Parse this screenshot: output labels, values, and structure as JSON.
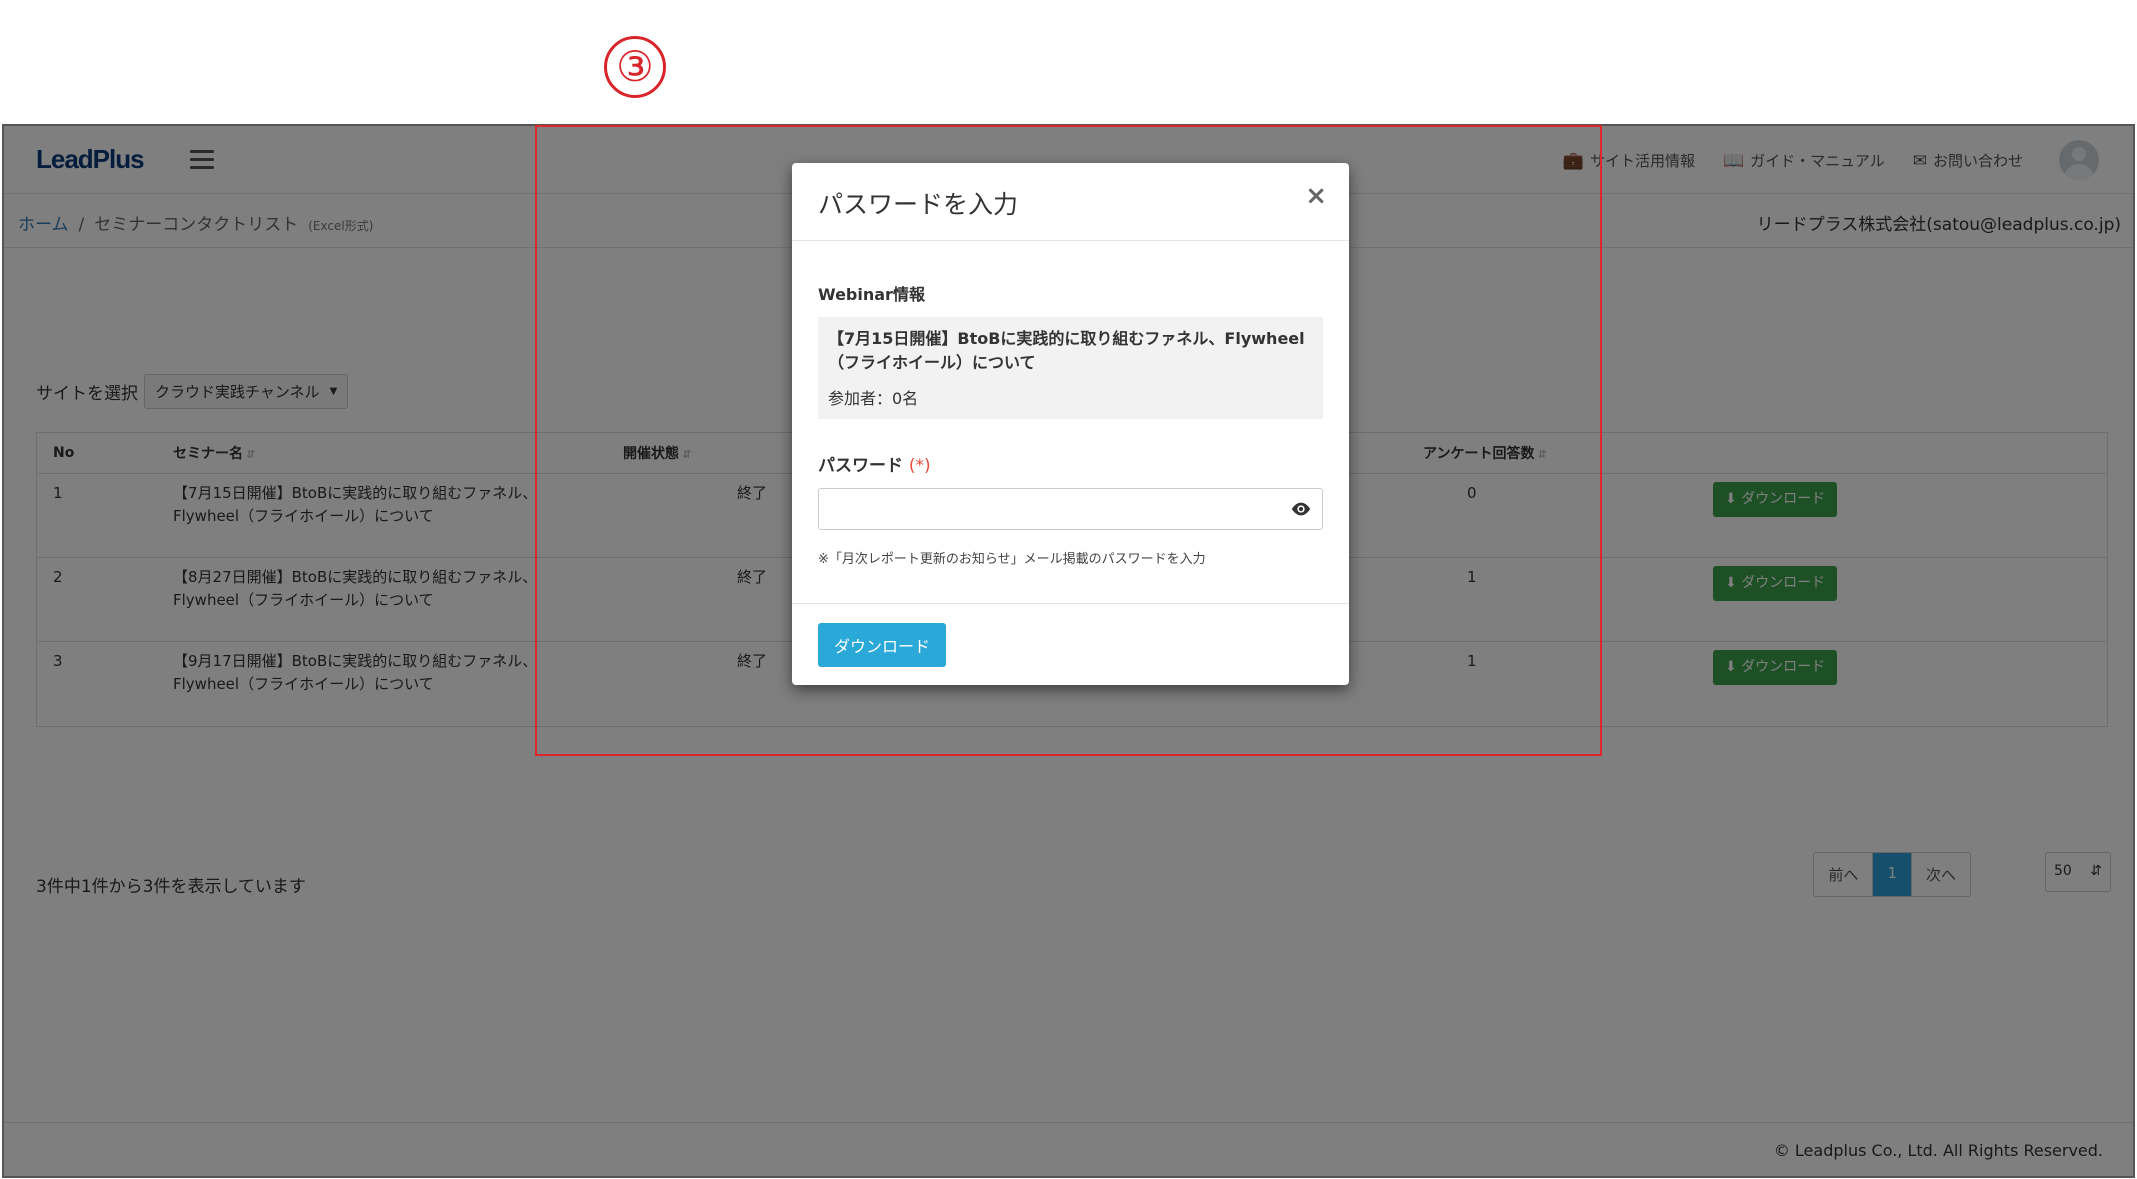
{
  "marker": "③",
  "navbar": {
    "logo": "LeadPlus",
    "links": [
      {
        "icon": "briefcase-icon",
        "label": "サイト活用情報"
      },
      {
        "icon": "book-icon",
        "label": "ガイド・マニュアル"
      },
      {
        "icon": "envelope-icon",
        "label": "お問い合わせ"
      }
    ]
  },
  "breadcrumb": {
    "home": "ホーム",
    "separator": "/",
    "current": "セミナーコンタクトリスト",
    "current_note": "(Excel形式)"
  },
  "account": "リードプラス株式会社(satou@leadplus.co.jp)",
  "site_select": {
    "label": "サイトを選択",
    "value": "クラウド実践チャンネル"
  },
  "table": {
    "headers": {
      "no": "No",
      "title": "セミナー名",
      "status": "開催状態",
      "answers": "アンケート回答数"
    },
    "rows": [
      {
        "no": "1",
        "title": "【7月15日開催】BtoBに実践的に取り組むファネル、Flywheel（フライホイール）について",
        "status": "終了",
        "answers": "0",
        "action": "ダウンロード"
      },
      {
        "no": "2",
        "title": "【8月27日開催】BtoBに実践的に取り組むファネル、Flywheel（フライホイール）について",
        "status": "終了",
        "answers": "1",
        "action": "ダウンロード"
      },
      {
        "no": "3",
        "title": "【9月17日開催】BtoBに実践的に取り組むファネル、Flywheel（フライホイール）について",
        "status": "終了",
        "answers": "1",
        "action": "ダウンロード"
      }
    ]
  },
  "summary": "3件中1件から3件を表示しています",
  "pager": {
    "prev": "前へ",
    "current": "1",
    "next": "次へ",
    "page_size": "50"
  },
  "footer": "© Leadplus Co., Ltd. All Rights Reserved.",
  "modal": {
    "title": "パスワードを入力",
    "close": "×",
    "webinar_label": "Webinar情報",
    "webinar_title": "【7月15日開催】BtoBに実践的に取り組むファネル、Flywheel（フライホイール）について",
    "participants": "参加者：0名",
    "password_label": "パスワード",
    "required": "(*)",
    "password_value": "",
    "hint": "※「月次レポート更新のお知らせ」メール掲載のパスワードを入力",
    "submit": "ダウンロード"
  },
  "colors": {
    "annotation": "#e0252b",
    "primary": "#2aa8d8",
    "success": "#3aa04a",
    "link": "#337ab7"
  }
}
